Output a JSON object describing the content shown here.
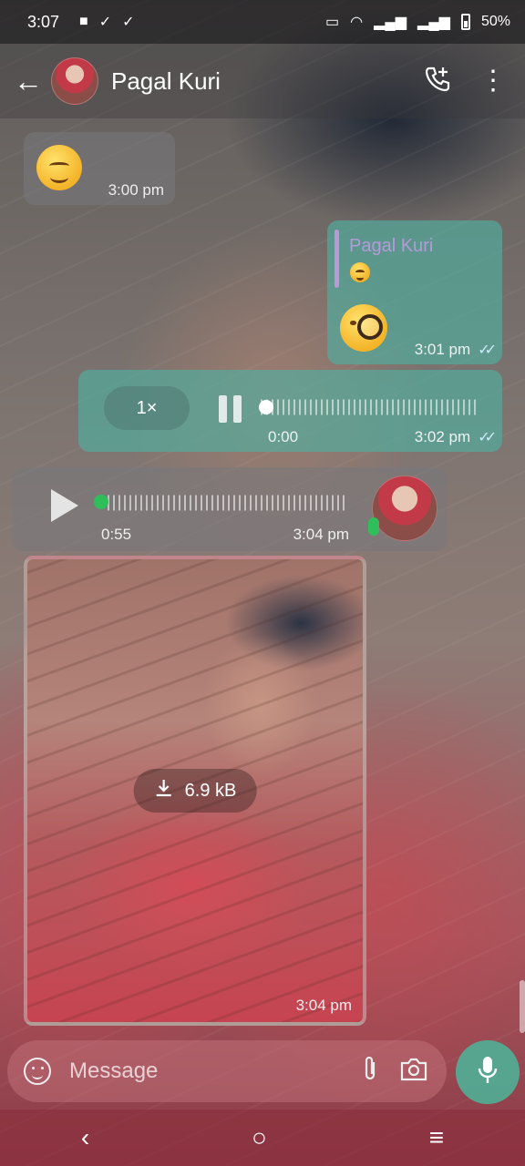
{
  "status_bar": {
    "time": "3:07",
    "battery": "50%"
  },
  "header": {
    "title": "Pagal Kuri"
  },
  "messages": [
    {
      "type": "emoji",
      "direction": "incoming",
      "time": "3:00 pm"
    },
    {
      "type": "reply",
      "direction": "outgoing",
      "reply_to_name": "Pagal Kuri",
      "time": "3:01 pm"
    },
    {
      "type": "voice",
      "direction": "outgoing",
      "speed": "1×",
      "elapsed": "0:00",
      "time": "3:02 pm"
    },
    {
      "type": "voice",
      "direction": "incoming",
      "duration": "0:55",
      "time": "3:04 pm"
    },
    {
      "type": "photo",
      "direction": "incoming",
      "size": "6.9 kB",
      "time": "3:04 pm"
    }
  ],
  "composer": {
    "placeholder": "Message"
  },
  "colors": {
    "outgoing_bubble": "#50afa0",
    "reply_accent": "#b89ad6",
    "mic_button": "#50af96",
    "playback_dot": "#2fbf5a"
  }
}
